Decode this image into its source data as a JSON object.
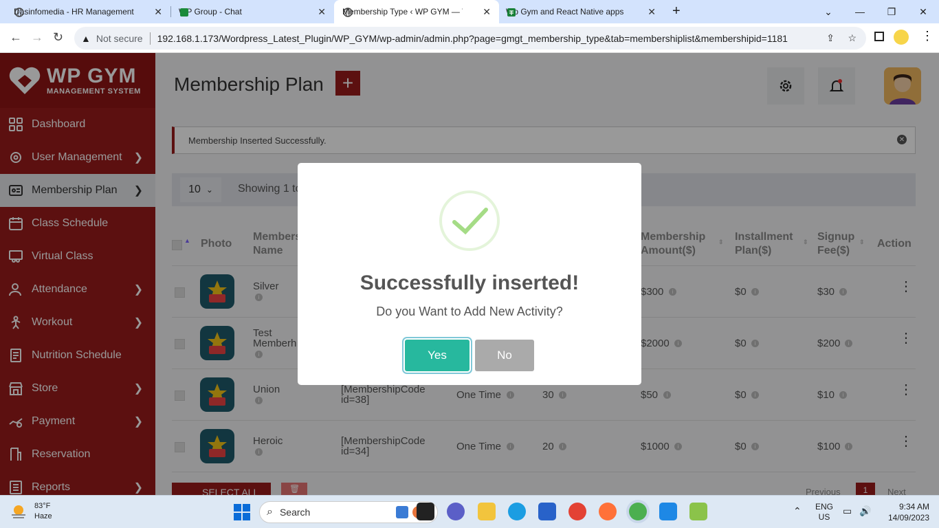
{
  "browser": {
    "tabs": [
      {
        "title": "Dasinfomedia - HR Management"
      },
      {
        "title": "WP Group - Chat"
      },
      {
        "title": "Membership Type ‹ WP GYM — V"
      },
      {
        "title": "Wp Gym and React Native apps"
      }
    ],
    "security": "Not secure",
    "url": "192.168.1.173/Wordpress_Latest_Plugin/WP_GYM/wp-admin/admin.php?page=gmgt_membership_type&tab=membershiplist&membershipid=1181"
  },
  "sidebar": {
    "logo_main": "WP GYM",
    "logo_sub": "MANAGEMENT SYSTEM",
    "items": [
      {
        "label": "Dashboard"
      },
      {
        "label": "User Management"
      },
      {
        "label": "Membership Plan"
      },
      {
        "label": "Class Schedule"
      },
      {
        "label": "Virtual Class"
      },
      {
        "label": "Attendance"
      },
      {
        "label": "Workout"
      },
      {
        "label": "Nutrition Schedule"
      },
      {
        "label": "Store"
      },
      {
        "label": "Payment"
      },
      {
        "label": "Reservation"
      },
      {
        "label": "Reports"
      }
    ]
  },
  "main": {
    "title": "Membership Plan",
    "add_symbol": "+",
    "alert": "Membership Inserted Successfully.",
    "page_size": "10",
    "showing": "Showing 1 to",
    "columns": {
      "photo": "Photo",
      "name": "Members\nName",
      "amount": "Membership\nAmount($)",
      "installment": "Installment\nPlan($)",
      "signup": "Signup\nFee($)",
      "action": "Action"
    },
    "rows": [
      {
        "name": "Silver",
        "code": "",
        "period": "",
        "days": "",
        "amount": "$300",
        "installment": "$0",
        "signup": "$30"
      },
      {
        "name": "Test\nMemberh",
        "code": "",
        "period": "",
        "days": "",
        "amount": "$2000",
        "installment": "$0",
        "signup": "$200"
      },
      {
        "name": "Union",
        "code": "[MembershipCode\nid=38]",
        "period": "One Time",
        "days": "30",
        "amount": "$50",
        "installment": "$0",
        "signup": "$10"
      },
      {
        "name": "Heroic",
        "code": "[MembershipCode\nid=34]",
        "period": "One Time",
        "days": "20",
        "amount": "$1000",
        "installment": "$0",
        "signup": "$100"
      }
    ],
    "select_all": "SELECT ALL",
    "previous": "Previous",
    "page": "1",
    "next": "Next"
  },
  "dialog": {
    "title": "Successfully inserted!",
    "text": "Do you Want to Add New Activity?",
    "yes": "Yes",
    "no": "No"
  },
  "taskbar": {
    "temp": "83°F",
    "weather": "Haze",
    "search": "Search",
    "lang1": "ENG",
    "lang2": "US",
    "time": "9:34 AM",
    "date": "14/09/2023"
  },
  "colors": {
    "brand": "#991b1b",
    "yes": "#27b89e",
    "check": "#a5dc86"
  }
}
